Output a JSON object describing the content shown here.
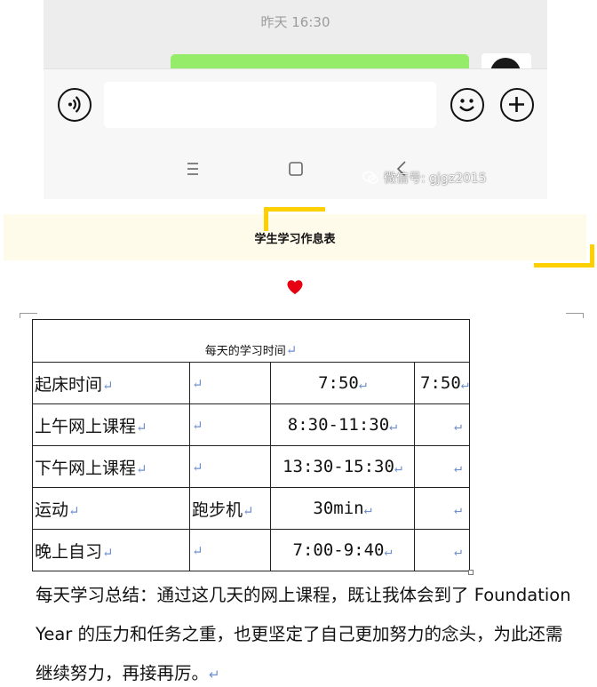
{
  "chat": {
    "timestamp": "昨天 16:30",
    "input_placeholder": "",
    "watermark": "微信号: gjgz2015"
  },
  "section": {
    "title": "学生学习作息表",
    "accent_color": "#ffd000",
    "heart_color": "#e60012"
  },
  "schedule": {
    "caption": "每天的学习时间",
    "rows": [
      {
        "activity": "起床时间",
        "detail": "",
        "time": "7:50",
        "extra": "7:50"
      },
      {
        "activity": "上午网上课程",
        "detail": "",
        "time": "8:30-11:30",
        "extra": ""
      },
      {
        "activity": "下午网上课程",
        "detail": "",
        "time": "13:30-15:30",
        "extra": ""
      },
      {
        "activity": "运动",
        "detail": "跑步机",
        "time": "30min",
        "extra": ""
      },
      {
        "activity": "晚上自习",
        "detail": "",
        "time": "7:00-9:40",
        "extra": ""
      }
    ],
    "return_mark": "↵"
  },
  "summary": {
    "text": "每天学习总结：通过这几天的网上课程，既让我体会到了 Foundation Year 的压力和任务之重，也更坚定了自己更加努力的念头，为此还需继续努力，再接再厉。"
  }
}
